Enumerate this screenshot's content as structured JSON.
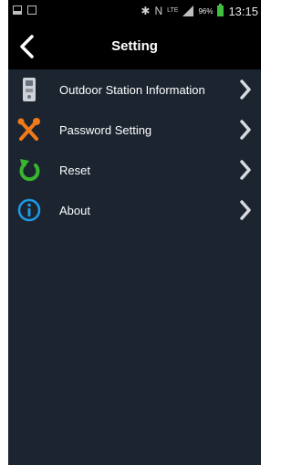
{
  "status_bar": {
    "battery_percent": "96%",
    "network": "LTE",
    "time": "13:15"
  },
  "header": {
    "title": "Setting"
  },
  "menu": {
    "items": [
      {
        "label": "Outdoor Station Information",
        "icon": "outdoor-station-icon"
      },
      {
        "label": "Password Setting",
        "icon": "tools-icon"
      },
      {
        "label": "Reset",
        "icon": "reset-icon"
      },
      {
        "label": "About",
        "icon": "info-icon"
      }
    ]
  },
  "colors": {
    "background": "#1c2430",
    "header": "#000000",
    "tools_accent": "#f07a1a",
    "reset_accent": "#37b62f",
    "info_accent": "#1e9ae6"
  }
}
